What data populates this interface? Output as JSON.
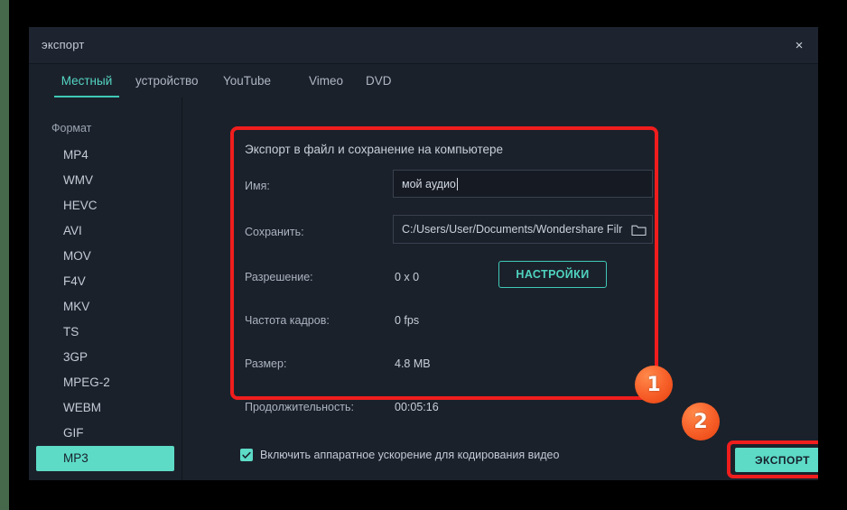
{
  "window": {
    "title": "экспорт",
    "close_label": "×"
  },
  "tabs": [
    {
      "label": "Местный",
      "active": true
    },
    {
      "label": "устройство",
      "active": false
    },
    {
      "label": "YouTube",
      "active": false
    },
    {
      "label": "Vimeo",
      "active": false
    },
    {
      "label": "DVD",
      "active": false
    }
  ],
  "sidebar": {
    "title": "Формат",
    "items": [
      {
        "label": "MP4",
        "selected": false
      },
      {
        "label": "WMV",
        "selected": false
      },
      {
        "label": "HEVC",
        "selected": false
      },
      {
        "label": "AVI",
        "selected": false
      },
      {
        "label": "MOV",
        "selected": false
      },
      {
        "label": "F4V",
        "selected": false
      },
      {
        "label": "MKV",
        "selected": false
      },
      {
        "label": "TS",
        "selected": false
      },
      {
        "label": "3GP",
        "selected": false
      },
      {
        "label": "MPEG-2",
        "selected": false
      },
      {
        "label": "WEBM",
        "selected": false
      },
      {
        "label": "GIF",
        "selected": false
      },
      {
        "label": "MP3",
        "selected": true
      }
    ]
  },
  "form": {
    "heading": "Экспорт в файл и сохранение на компьютере",
    "name_label": "Имя:",
    "name_value": "мой аудио",
    "save_label": "Сохранить:",
    "save_value": "C:/Users/User/Documents/Wondershare Filr",
    "folder_icon": "folder-icon",
    "resolution_label": "Разрешение:",
    "resolution_value": "0 x 0",
    "settings_button": "НАСТРОЙКИ",
    "framerate_label": "Частота кадров:",
    "framerate_value": "0 fps",
    "size_label": "Размер:",
    "size_value": "4.8 MB",
    "duration_label": "Продолжительность:",
    "duration_value": "00:05:16"
  },
  "bottom": {
    "checkbox_label": "Включить аппаратное ускорение для кодирования видео",
    "checkbox_checked": true,
    "export_button": "ЭКСПОРТ"
  },
  "annotations": {
    "badge_one": "1",
    "badge_two": "2",
    "highlight_color": "#f01d1d",
    "badge_color": "#f8622b"
  },
  "colors": {
    "accent_teal": "#5ddbc7",
    "dialog_bg": "#1b212b",
    "titlebar_bg": "#1e242f",
    "desktop_green": "#45694a"
  }
}
